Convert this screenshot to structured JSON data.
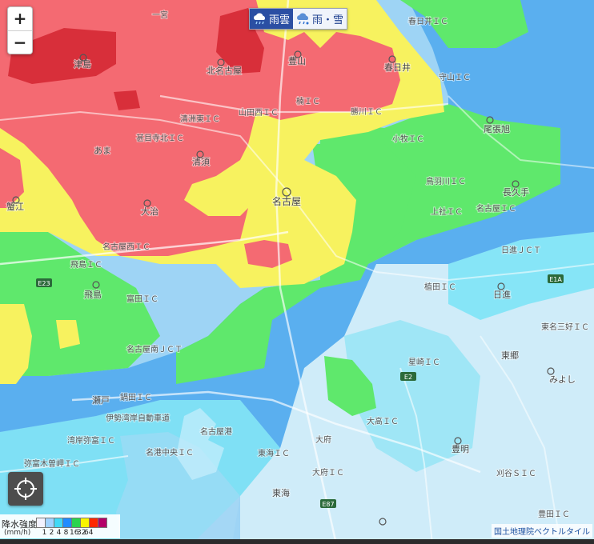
{
  "zoom": {
    "in_label": "+",
    "out_label": "−"
  },
  "layers": [
    {
      "label": "雨雲",
      "icon": "rain-cloud-icon",
      "active": true
    },
    {
      "label": "雨・雪",
      "icon": "rain-snow-cloud-icon",
      "active": false
    }
  ],
  "legend": {
    "title": "降水強度",
    "unit": "(mm/h)",
    "colors": [
      "#f2f2ff",
      "#a0d2ff",
      "#41d8f5",
      "#218cff",
      "#2bd44f",
      "#faf500",
      "#ff2800",
      "#b40068"
    ],
    "ticks": [
      "1",
      "2",
      "4",
      "8",
      "16",
      "32",
      "64"
    ]
  },
  "attribution": "国土地理院ベクトルタイル",
  "map": {
    "precip_colors": {
      "very_light": "#cbeaf8",
      "light_cyan": "#78e2f5",
      "blue": "#5ab3ef",
      "green": "#5eea6e",
      "yellow": "#f7f25f",
      "salmon": "#f46a71",
      "red": "#d82f3a"
    },
    "labels": {
      "ichinomiya": "一宮",
      "kasugai": "春日井ＩＣ",
      "tsushima": "津島",
      "kitanagoya": "北名古屋",
      "toyoyama": "豊山",
      "kasugai_city": "春日井",
      "komaki": "小牧ＩＣ",
      "kiyosu_higashi": "清洲東ＩＣ",
      "yamada_nishi": "山田西ＩＣ",
      "kusunoki": "楠ＩＣ",
      "katsugawa": "勝川ＩＣ",
      "kanogawa": "鳥羽川ＩＣ",
      "ama_ic": "甚目寺北ＩＣ",
      "ama": "あま",
      "kiyosu": "清須",
      "owariasahi": "尾張旭",
      "moriyama": "守山ＩＣ",
      "nagakute": "長久手",
      "kamiyashiro": "上社ＩＣ",
      "nagoya_ic": "名古屋ＩＣ",
      "nagoya": "名古屋",
      "oharu": "大治",
      "kanie": "蟹江",
      "tobishima": "飛島",
      "nisshin": "日進ＪＣＴ",
      "nisshin_city": "日進",
      "yagoto": "植田ＩＣ",
      "tomida": "富田ＩＣ",
      "toyoake": "豊明",
      "tokai": "東海",
      "obu": "大府ＩＣ",
      "kariya": "刈谷ＳＩＣ",
      "toyota": "東名三好ＩＣ",
      "miyoshi": "みよし",
      "togo": "東郷",
      "nagoya_minato": "名古屋港",
      "tokai_ic": "東海ＩＣ",
      "obu_city": "大府",
      "kyowa": "大高ＩＣ",
      "tobishima_ic": "飛島ＩＣ",
      "wangan": "湾岸弥富ＩＣ",
      "ise_wangan": "伊勢湾岸自動車道",
      "nabeta": "鍋田ＩＣ",
      "chita": "名港中央ＩＣ",
      "sakae": "星崎ＩＣ",
      "yatomi": "弥富木曽岬ＩＣ",
      "shiomi": "名古屋南ＪＣＴ",
      "kanayama": "豊田ＩＣ",
      "nakamura": "名古屋西ＩＣ",
      "seto": "瀬戸",
      "road_e2a": "E1A",
      "road_e23": "E23",
      "road_e87": "E87",
      "road_e1a2": "E1A",
      "road_e2": "E2"
    }
  }
}
